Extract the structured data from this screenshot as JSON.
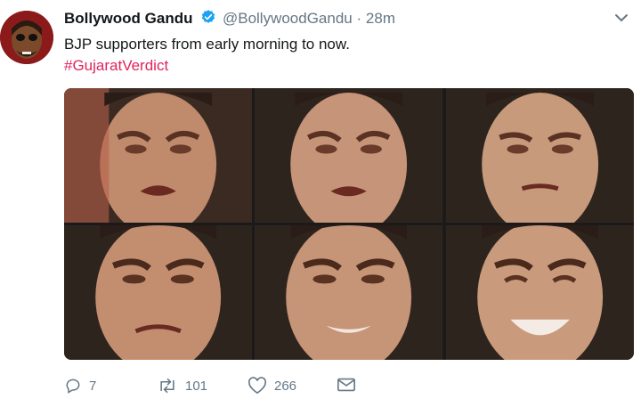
{
  "tweet": {
    "author_name": "Bollywood Gandu",
    "handle": "@BollywoodGandu",
    "separator": "·",
    "time": "28m",
    "text": "BJP supporters from early morning to now.",
    "hashtag": "#GujaratVerdict"
  },
  "media": {
    "frames": [
      {
        "expression": "crying"
      },
      {
        "expression": "crying"
      },
      {
        "expression": "sad"
      },
      {
        "expression": "teary"
      },
      {
        "expression": "smiling-tears"
      },
      {
        "expression": "laughing"
      }
    ]
  },
  "actions": {
    "reply_count": "7",
    "retweet_count": "101",
    "like_count": "266"
  },
  "icons": [
    "verified-badge-icon",
    "chevron-down-icon",
    "reply-icon",
    "retweet-icon",
    "like-icon",
    "message-icon"
  ],
  "colors": {
    "hashtag": "#e0245e",
    "verified": "#1da1f2",
    "muted": "#657786"
  }
}
